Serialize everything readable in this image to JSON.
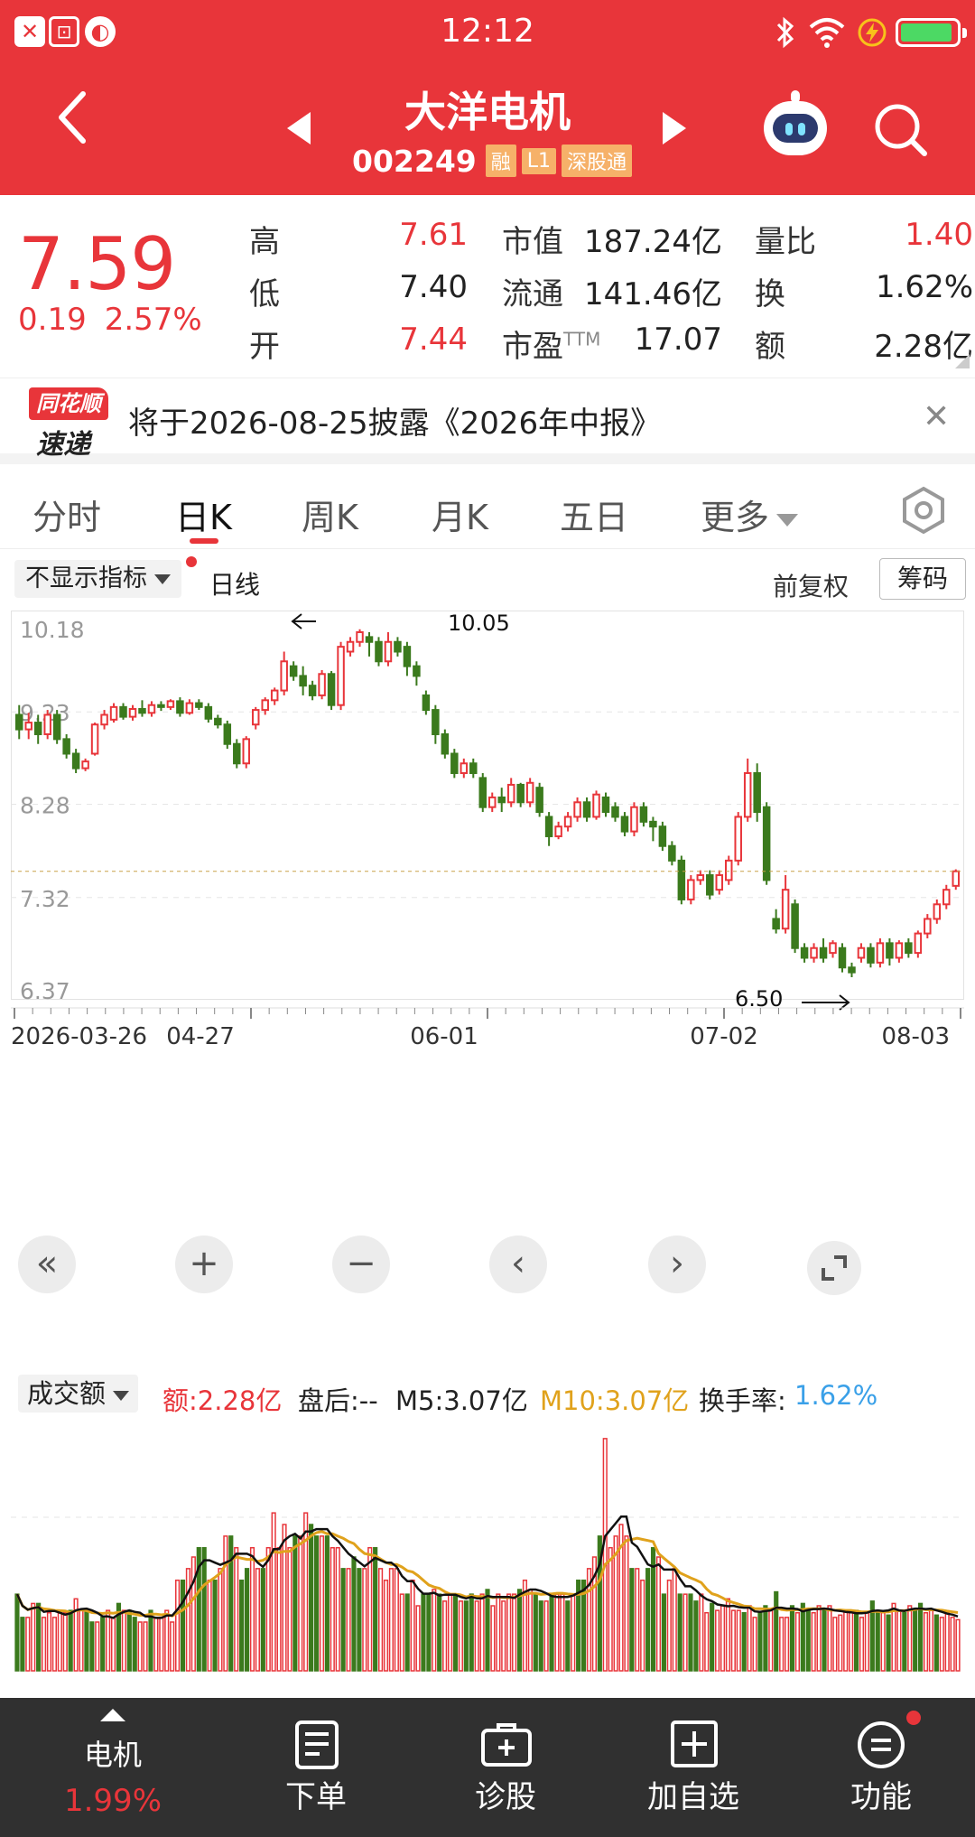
{
  "status_bar": {
    "time": "12:12"
  },
  "header": {
    "name": "大洋电机",
    "code": "002249",
    "tags": [
      "融",
      "L1",
      "深股通"
    ]
  },
  "quote": {
    "price": "7.59",
    "change": "0.19",
    "change_pct": "2.57%",
    "col1": [
      {
        "label": "高",
        "value": "7.61"
      },
      {
        "label": "低",
        "value": "7.40"
      },
      {
        "label": "开",
        "value": "7.44"
      }
    ],
    "col2": [
      {
        "label": "市值",
        "value": "187.24亿"
      },
      {
        "label": "流通",
        "value": "141.46亿"
      },
      {
        "label": "市盈",
        "label_sup": "TTM",
        "value": "17.07"
      }
    ],
    "col3": [
      {
        "label": "量比",
        "value": "1.40"
      },
      {
        "label": "换",
        "value": "1.62%"
      },
      {
        "label": "额",
        "value": "2.28亿"
      }
    ]
  },
  "notice": {
    "logo_top": "同花顺",
    "logo_bottom": "速递",
    "text": "将于2026-08-25披露《2026年中报》"
  },
  "tabs": [
    "分时",
    "日K",
    "周K",
    "月K",
    "五日",
    "更多"
  ],
  "indicator": {
    "select": "不显示指标",
    "type": "日线",
    "adjust": "前复权",
    "chips_button": "筹码"
  },
  "colors": {
    "up": "#e8353a",
    "down": "#3b7a1d",
    "ma5": "#111111",
    "ma10": "#e0a21c",
    "turnover": "#3aa0e8",
    "header_bg": "#e8353a",
    "bottom_bar": "#303030"
  },
  "volume": {
    "select": "成交额",
    "amount": "额:2.28亿",
    "after": "盘后:--",
    "m5": "M5:3.07亿",
    "m10": "M10:3.07亿",
    "turnover_label": "换手率:",
    "turnover_value": "1.62%"
  },
  "bottom_bar": {
    "item1_label": "电机",
    "item1_change": "1.99%",
    "items": [
      "下单",
      "诊股",
      "加自选",
      "功能"
    ]
  },
  "chart_data": {
    "type": "candlestick",
    "y_ticks": [
      "10.18",
      "9.23",
      "8.28",
      "7.32",
      "6.37"
    ],
    "x_ticks": [
      "2026-03-26",
      "04-27",
      "06-01",
      "07-02",
      "08-03"
    ],
    "high_label": "10.05",
    "low_label": "6.50",
    "ylim": [
      6.37,
      10.18
    ],
    "last_price": 7.59,
    "candles": [
      [
        9.2,
        9.05,
        9.3,
        8.95
      ],
      [
        9.05,
        9.12,
        9.22,
        8.95
      ],
      [
        9.12,
        9.0,
        9.2,
        8.9
      ],
      [
        9.0,
        9.2,
        9.25,
        8.95
      ],
      [
        9.2,
        8.95,
        9.25,
        8.9
      ],
      [
        8.95,
        8.8,
        9.0,
        8.75
      ],
      [
        8.8,
        8.65,
        8.85,
        8.6
      ],
      [
        8.65,
        8.72,
        8.75,
        8.62
      ],
      [
        8.8,
        9.1,
        9.12,
        8.78
      ],
      [
        9.1,
        9.2,
        9.25,
        9.05
      ],
      [
        9.15,
        9.28,
        9.32,
        9.12
      ],
      [
        9.28,
        9.18,
        9.32,
        9.15
      ],
      [
        9.18,
        9.26,
        9.3,
        9.14
      ],
      [
        9.26,
        9.22,
        9.35,
        9.18
      ],
      [
        9.22,
        9.3,
        9.34,
        9.18
      ],
      [
        9.3,
        9.28,
        9.34,
        9.24
      ],
      [
        9.28,
        9.34,
        9.36,
        9.25
      ],
      [
        9.34,
        9.22,
        9.38,
        9.18
      ],
      [
        9.22,
        9.32,
        9.36,
        9.2
      ],
      [
        9.32,
        9.28,
        9.36,
        9.25
      ],
      [
        9.28,
        9.16,
        9.32,
        9.12
      ],
      [
        9.16,
        9.1,
        9.2,
        9.06
      ],
      [
        9.1,
        8.9,
        9.14,
        8.85
      ],
      [
        8.9,
        8.7,
        8.95,
        8.65
      ],
      [
        8.7,
        8.95,
        8.98,
        8.65
      ],
      [
        9.1,
        9.25,
        9.28,
        9.05
      ],
      [
        9.25,
        9.35,
        9.38,
        9.2
      ],
      [
        9.35,
        9.45,
        9.48,
        9.3
      ],
      [
        9.45,
        9.75,
        9.85,
        9.4
      ],
      [
        9.7,
        9.6,
        9.75,
        9.55
      ],
      [
        9.6,
        9.5,
        9.7,
        9.4
      ],
      [
        9.5,
        9.4,
        9.55,
        9.35
      ],
      [
        9.4,
        9.62,
        9.66,
        9.36
      ],
      [
        9.62,
        9.3,
        9.65,
        9.25
      ],
      [
        9.3,
        9.9,
        9.95,
        9.25
      ],
      [
        9.85,
        9.95,
        10.0,
        9.8
      ],
      [
        9.95,
        10.05,
        10.08,
        9.9
      ],
      [
        10.0,
        9.95,
        10.05,
        9.8
      ],
      [
        9.95,
        9.75,
        10.0,
        9.7
      ],
      [
        9.75,
        9.95,
        10.05,
        9.7
      ],
      [
        9.95,
        9.85,
        10.0,
        9.8
      ],
      [
        9.9,
        9.7,
        9.95,
        9.6
      ],
      [
        9.7,
        9.6,
        9.75,
        9.5
      ],
      [
        9.4,
        9.25,
        9.45,
        9.2
      ],
      [
        9.25,
        9.0,
        9.3,
        8.9
      ],
      [
        9.0,
        8.8,
        9.05,
        8.75
      ],
      [
        8.8,
        8.6,
        8.85,
        8.55
      ],
      [
        8.6,
        8.7,
        8.75,
        8.55
      ],
      [
        8.7,
        8.6,
        8.75,
        8.55
      ],
      [
        8.55,
        8.25,
        8.6,
        8.2
      ],
      [
        8.25,
        8.35,
        8.4,
        8.2
      ],
      [
        8.35,
        8.3,
        8.45,
        8.2
      ],
      [
        8.3,
        8.48,
        8.55,
        8.25
      ],
      [
        8.48,
        8.3,
        8.5,
        8.25
      ],
      [
        8.3,
        8.5,
        8.55,
        8.25
      ],
      [
        8.45,
        8.2,
        8.5,
        8.15
      ],
      [
        8.15,
        7.95,
        8.2,
        7.85
      ],
      [
        7.95,
        8.05,
        8.1,
        7.92
      ],
      [
        8.05,
        8.15,
        8.2,
        8.0
      ],
      [
        8.15,
        8.3,
        8.35,
        8.1
      ],
      [
        8.3,
        8.15,
        8.35,
        8.1
      ],
      [
        8.15,
        8.38,
        8.42,
        8.12
      ],
      [
        8.35,
        8.2,
        8.4,
        8.15
      ],
      [
        8.25,
        8.15,
        8.3,
        8.1
      ],
      [
        8.15,
        8.0,
        8.2,
        7.95
      ],
      [
        8.0,
        8.25,
        8.3,
        7.95
      ],
      [
        8.25,
        8.1,
        8.3,
        8.05
      ],
      [
        8.1,
        8.05,
        8.15,
        7.9
      ],
      [
        8.05,
        7.85,
        8.1,
        7.8
      ],
      [
        7.85,
        7.7,
        7.9,
        7.65
      ],
      [
        7.7,
        7.3,
        7.75,
        7.25
      ],
      [
        7.3,
        7.5,
        7.55,
        7.25
      ],
      [
        7.5,
        7.55,
        7.6,
        7.45
      ],
      [
        7.55,
        7.35,
        7.6,
        7.3
      ],
      [
        7.4,
        7.55,
        7.6,
        7.35
      ],
      [
        7.5,
        7.7,
        7.75,
        7.45
      ],
      [
        7.7,
        8.15,
        8.2,
        7.65
      ],
      [
        8.15,
        8.6,
        8.75,
        8.1
      ],
      [
        8.6,
        8.2,
        8.7,
        8.1
      ],
      [
        8.25,
        7.5,
        8.3,
        7.45
      ],
      [
        7.1,
        7.0,
        7.2,
        6.95
      ],
      [
        7.0,
        7.4,
        7.55,
        6.95
      ],
      [
        7.25,
        6.8,
        7.3,
        6.75
      ],
      [
        6.8,
        6.7,
        6.85,
        6.65
      ],
      [
        6.7,
        6.8,
        6.85,
        6.65
      ],
      [
        6.8,
        6.7,
        6.9,
        6.65
      ],
      [
        6.75,
        6.85,
        6.88,
        6.7
      ],
      [
        6.8,
        6.6,
        6.85,
        6.55
      ],
      [
        6.6,
        6.55,
        6.65,
        6.5
      ],
      [
        6.7,
        6.8,
        6.85,
        6.65
      ],
      [
        6.8,
        6.65,
        6.85,
        6.6
      ],
      [
        6.65,
        6.85,
        6.9,
        6.6
      ],
      [
        6.85,
        6.7,
        6.9,
        6.62
      ],
      [
        6.7,
        6.85,
        6.88,
        6.65
      ],
      [
        6.85,
        6.75,
        6.9,
        6.7
      ],
      [
        6.75,
        6.95,
        6.98,
        6.7
      ],
      [
        6.95,
        7.1,
        7.15,
        6.9
      ],
      [
        7.1,
        7.25,
        7.3,
        7.05
      ],
      [
        7.25,
        7.4,
        7.45,
        7.2
      ],
      [
        7.44,
        7.59,
        7.61,
        7.4
      ]
    ],
    "volume": [
      3.3,
      2.3,
      2.3,
      2.9,
      2.9,
      2.3,
      2.5,
      2.3,
      2.5,
      2.5,
      2.6,
      3.1,
      2.6,
      2.6,
      2.1,
      2.1,
      2.3,
      2.6,
      2.3,
      2.9,
      2.6,
      2.6,
      2.3,
      2.1,
      2.1,
      2.6,
      2.3,
      2.3,
      2.6,
      2.1,
      3.9,
      3.9,
      4.4,
      4.9,
      5.3,
      5.3,
      3.9,
      3.9,
      4.4,
      5.8,
      5.8,
      5.3,
      3.9,
      4.4,
      5.3,
      4.4,
      4.4,
      5.3,
      6.8,
      5.3,
      6.3,
      5.3,
      5.8,
      5.8,
      6.8,
      6.3,
      5.8,
      5.8,
      5.8,
      5.3,
      5.3,
      4.4,
      4.4,
      4.9,
      4.4,
      4.4,
      5.3,
      5.3,
      4.4,
      3.9,
      4.4,
      4.4,
      3.3,
      3.3,
      3.9,
      2.8,
      3.3,
      3.3,
      3.5,
      3.3,
      3.0,
      3.3,
      3.3,
      3.0,
      3.0,
      3.3,
      3.0,
      3.3,
      3.5,
      2.8,
      3.3,
      3.0,
      3.3,
      3.3,
      3.5,
      3.9,
      3.5,
      3.3,
      3.0,
      3.0,
      3.3,
      3.3,
      3.3,
      3.0,
      3.3,
      3.9,
      3.9,
      4.4,
      4.9,
      5.8,
      10.0,
      5.3,
      5.8,
      6.3,
      5.8,
      4.4,
      4.4,
      3.9,
      4.4,
      5.3,
      4.9,
      3.3,
      3.9,
      4.4,
      3.3,
      3.3,
      3.3,
      3.0,
      3.3,
      2.5,
      2.9,
      2.6,
      2.8,
      3.1,
      2.6,
      2.6,
      2.5,
      2.8,
      2.3,
      2.5,
      2.8,
      2.6,
      3.4,
      2.3,
      2.3,
      2.8,
      2.5,
      2.9,
      2.6,
      2.5,
      2.8,
      2.6,
      2.8,
      2.3,
      2.4,
      2.6,
      2.5,
      2.6,
      2.3,
      2.5,
      3.0,
      2.6,
      2.5,
      2.4,
      2.9,
      2.6,
      2.5,
      2.8,
      2.6,
      2.9,
      2.5,
      2.6,
      2.4,
      2.3,
      2.5,
      2.3,
      2.2
    ]
  }
}
